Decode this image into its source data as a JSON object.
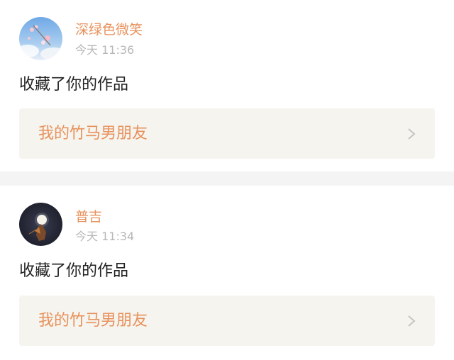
{
  "notifications": [
    {
      "avatar": "avatar-sky-flowers",
      "username": "深绿色微笑",
      "time": "今天 11:36",
      "action": "收藏了你的作品",
      "work_title": "我的竹马男朋友",
      "arrow_icon": "chevron-right-icon"
    },
    {
      "avatar": "avatar-moon-night",
      "username": "普吉",
      "time": "今天 11:34",
      "action": "收藏了你的作品",
      "work_title": "我的竹马男朋友",
      "arrow_icon": "chevron-right-icon"
    }
  ],
  "colors": {
    "accent": "#e8915c",
    "timestamp": "#b7b7b7",
    "text": "#222222",
    "link_bg": "#f5f4ee",
    "divider": "#f4f4f4",
    "chevron": "#c4c4c4"
  }
}
